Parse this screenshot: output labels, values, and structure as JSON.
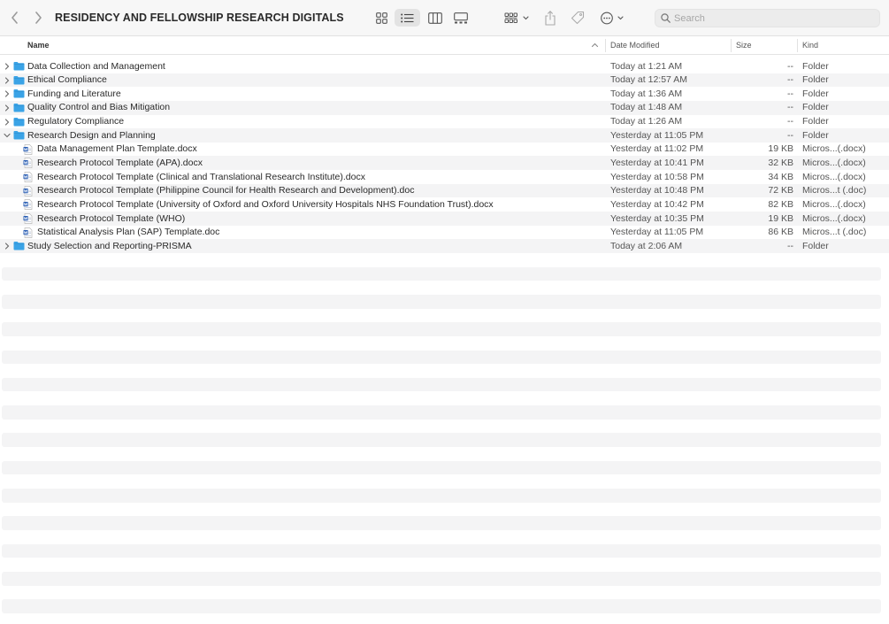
{
  "window": {
    "title": "RESIDENCY AND FELLOWSHIP RESEARCH DIGITALS"
  },
  "toolbar": {
    "back_icon": "chevron-left-icon",
    "forward_icon": "chevron-right-icon",
    "views": [
      "icon-view-icon",
      "list-view-icon",
      "column-view-icon",
      "gallery-view-icon"
    ],
    "active_view": "list-view-icon",
    "group_icon": "group-by-icon",
    "share_icon": "share-icon",
    "tag_icon": "tag-icon",
    "more_icon": "more-actions-icon"
  },
  "search": {
    "placeholder": "Search"
  },
  "columns": {
    "name": "Name",
    "date": "Date Modified",
    "size": "Size",
    "kind": "Kind"
  },
  "colors": {
    "folder": "#3aa3e6",
    "row_alt": "#f4f4f5",
    "doc_icon": "#2b5fb4"
  },
  "rows": [
    {
      "type": "folder",
      "expanded": false,
      "name": "Data Collection and Management",
      "date": "Today at 1:21 AM",
      "size": "--",
      "kind": "Folder"
    },
    {
      "type": "folder",
      "expanded": false,
      "name": "Ethical Compliance",
      "date": "Today at 12:57 AM",
      "size": "--",
      "kind": "Folder"
    },
    {
      "type": "folder",
      "expanded": false,
      "name": "Funding and Literature",
      "date": "Today at 1:36 AM",
      "size": "--",
      "kind": "Folder"
    },
    {
      "type": "folder",
      "expanded": false,
      "name": "Quality Control and Bias Mitigation",
      "date": "Today at 1:48 AM",
      "size": "--",
      "kind": "Folder"
    },
    {
      "type": "folder",
      "expanded": false,
      "name": "Regulatory Compliance",
      "date": "Today at 1:26 AM",
      "size": "--",
      "kind": "Folder"
    },
    {
      "type": "folder",
      "expanded": true,
      "name": "Research Design and Planning",
      "date": "Yesterday at 11:05 PM",
      "size": "--",
      "kind": "Folder"
    },
    {
      "type": "file",
      "name": "Data Management Plan Template.docx",
      "date": "Yesterday at 11:02 PM",
      "size": "19 KB",
      "kind": "Micros...(.docx)"
    },
    {
      "type": "file",
      "name": "Research Protocol Template (APA).docx",
      "date": "Yesterday at 10:41 PM",
      "size": "32 KB",
      "kind": "Micros...(.docx)"
    },
    {
      "type": "file",
      "name": "Research Protocol Template (Clinical and Translational Research Institute).docx",
      "date": "Yesterday at 10:58 PM",
      "size": "34 KB",
      "kind": "Micros...(.docx)"
    },
    {
      "type": "file",
      "name": "Research Protocol Template (Philippine Council for Health Research and Development).doc",
      "date": "Yesterday at 10:48 PM",
      "size": "72 KB",
      "kind": "Micros...t (.doc)"
    },
    {
      "type": "file",
      "name": "Research Protocol Template (University of Oxford and Oxford University Hospitals NHS Foundation Trust).docx",
      "date": "Yesterday at 10:42 PM",
      "size": "82 KB",
      "kind": "Micros...(.docx)"
    },
    {
      "type": "file",
      "name": "Research Protocol Template (WHO)",
      "date": "Yesterday at 10:35 PM",
      "size": "19 KB",
      "kind": "Micros...(.docx)"
    },
    {
      "type": "file",
      "name": "Statistical Analysis Plan (SAP) Template.doc",
      "date": "Yesterday at 11:05 PM",
      "size": "86 KB",
      "kind": "Micros...t (.doc)"
    },
    {
      "type": "folder",
      "expanded": false,
      "name": "Study Selection and Reporting-PRISMA",
      "date": "Today at 2:06 AM",
      "size": "--",
      "kind": "Folder"
    }
  ]
}
